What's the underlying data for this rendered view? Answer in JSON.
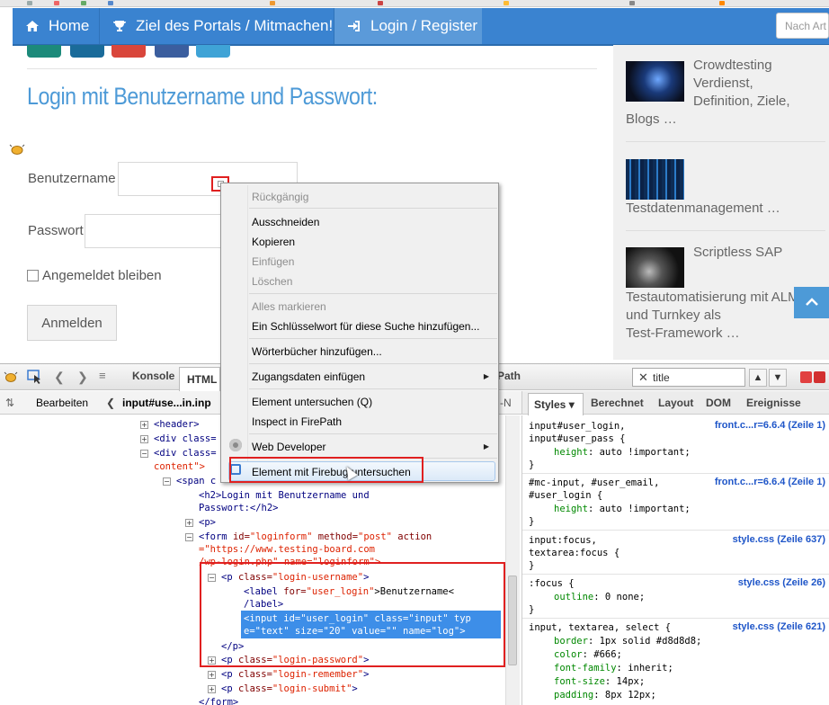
{
  "nav": {
    "home": "Home",
    "about": "Ziel des Portals / Mitmachen!",
    "login": "Login / Register",
    "search_placeholder": "Nach Art"
  },
  "main": {
    "heading": "Login mit Benutzername und Passwort:",
    "username_label": "Benutzername",
    "password_label": "Passwort",
    "remember_label": "Angemeldet bleiben",
    "submit_label": "Anmelden"
  },
  "sidebar": {
    "post1": {
      "title": "Crowdtesting Verdienst, Definition, Ziele,",
      "tail": "Blogs …"
    },
    "post2": {
      "title": "Testdatenmanagement …"
    },
    "post3": {
      "title": "Scriptless SAP",
      "tail1": "Testautomatisierung mit ALM",
      "tail2": "und Turnkey als",
      "tail3": "Test-Framework …"
    },
    "totop": "^"
  },
  "context_menu": {
    "undo": "Rückgängig",
    "cut": "Ausschneiden",
    "copy": "Kopieren",
    "paste": "Einfügen",
    "delete": "Löschen",
    "select_all": "Alles markieren",
    "add_keyword": "Ein Schlüsselwort für diese Suche hinzufügen...",
    "add_dictionaries": "Wörterbücher hinzufügen...",
    "insert_credentials": "Zugangsdaten einfügen",
    "inspect_element": "Element untersuchen (Q)",
    "inspect_firepath": "Inspect in FirePath",
    "web_developer": "Web Developer",
    "inspect_firebug": "Element mit Firebug untersuchen"
  },
  "firebug": {
    "tab_console": "Konsole",
    "tab_html": "HTML",
    "tab_path": "Path",
    "search_value": "title",
    "edit": "Bearbeiten",
    "breadcrumb": "input#use...in.inp",
    "side_tabs": [
      "Styles ▾",
      "Berechnet",
      "Layout",
      "DOM",
      "Ereignisse"
    ],
    "tree": {
      "l1": "<header>",
      "l2": "<div class=",
      "l3": "<div class=",
      "l4": "content\">",
      "l5": "<span c",
      "l6a": "<h2>Login mit Benutzername und",
      "l6b": "Passwort:</h2>",
      "l7": "<p>",
      "l8a_tag": "<form ",
      "l8a_id": "id=",
      "l8a_idv": "\"loginform\"",
      "l8a_m": " method=",
      "l8a_mv": "\"post\"",
      "l8a_a": " action",
      "l8b": "=\"https://www.testing-board.com",
      "l8c": "/wp-login.php\" name=\"loginform\">",
      "l9_tag": "<p ",
      "l9_attr": "class=",
      "l9_val": "\"login-username\"",
      "l9_end": ">",
      "l10_tag": "<label ",
      "l10_attr": "for=",
      "l10_val": "\"user_login\"",
      "l10_text": ">Benutzername<",
      "l10b": "/label>",
      "l11a": "<input id=\"user_login\" class=\"input\" typ",
      "l11b": "e=\"text\" size=\"20\" value=\"\" name=\"log\">",
      "l12": "</p>",
      "l13_val": "\"login-password\"",
      "l14_val": "\"login-remember\"",
      "l15_val": "\"login-submit\"",
      "l16": "</form>"
    },
    "styles": {
      "r1a": "input#user_login,",
      "r1b": "input#user_pass {",
      "r1c_p": "height",
      "r1c_v": ": auto !important;",
      "r1_src": "front.c...r=6.6.4 (Zeile 1)",
      "r2a": "#mc-input, #user_email,",
      "r2b": "#user_login {",
      "r2c_p": "height",
      "r2c_v": ": auto !important;",
      "r2_src": "front.c...r=6.6.4 (Zeile 1)",
      "r3a": "input:focus,",
      "r3b": "textarea:focus {",
      "r3_src": "style.css (Zeile 637)",
      "r4a": ":focus {",
      "r4b_p": "outline",
      "r4b_v": ": 0 none;",
      "r4_src": "style.css (Zeile 26)",
      "r5a": "input, textarea, select {",
      "r5_src": "style.css (Zeile 621)",
      "r5b_p": "border",
      "r5b_v": ": 1px solid #d8d8d8;",
      "r5c_p": "color",
      "r5c_v": ": #666;",
      "r5d_p": "font-family",
      "r5d_v": ": inherit;",
      "r5e_p": "font-size",
      "r5e_v": ": 14px;",
      "r5f_p": "padding",
      "r5f_v": ": 8px 12px;",
      "close": "}"
    }
  },
  "colors": {
    "nav_blue": "#3a83d0",
    "heading_blue": "#4d9ad7",
    "highlight_red": "#e02020",
    "selection_blue": "#3d8ee8"
  }
}
